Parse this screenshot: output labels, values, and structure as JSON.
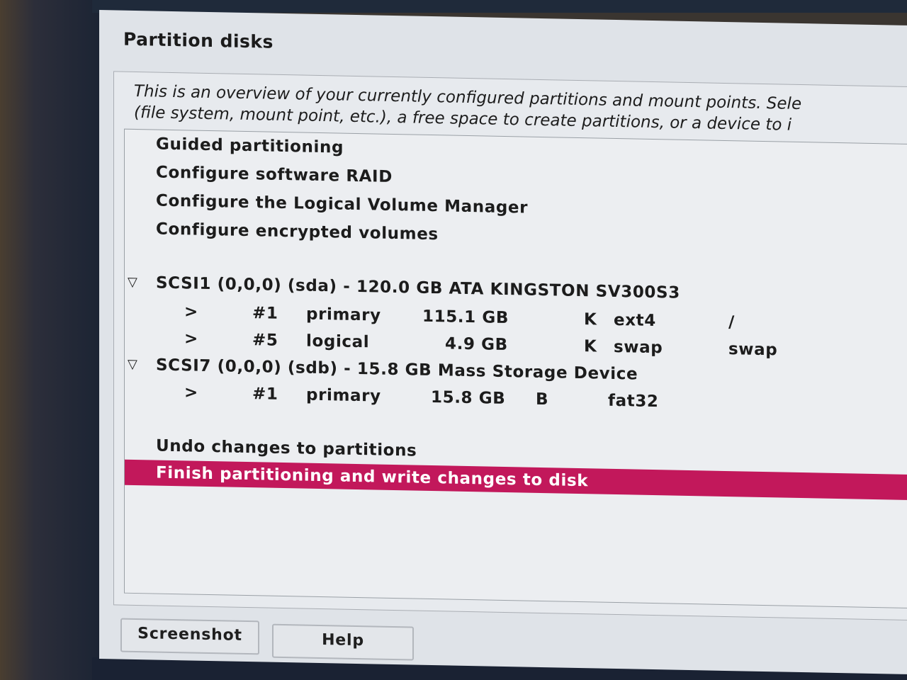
{
  "window": {
    "title": "Partition disks"
  },
  "intro": {
    "line1": "This is an overview of your currently configured partitions and mount points. Sele",
    "line2": "(file system, mount point, etc.), a free space to create partitions, or a device to i"
  },
  "menu": [
    "Guided partitioning",
    "Configure software RAID",
    "Configure the Logical Volume Manager",
    "Configure encrypted volumes"
  ],
  "disks": [
    {
      "label": "SCSI1 (0,0,0) (sda) - 120.0 GB ATA KINGSTON SV300S3",
      "partitions": [
        {
          "arrow": ">",
          "num": "#1",
          "type": "primary",
          "size": "115.1 GB",
          "flag": "K",
          "fs": "ext4",
          "mount": "/"
        },
        {
          "arrow": ">",
          "num": "#5",
          "type": "logical",
          "size": "4.9 GB",
          "flag": "K",
          "fs": "swap",
          "mount": "swap"
        }
      ]
    },
    {
      "label": "SCSI7 (0,0,0) (sdb) - 15.8 GB Mass Storage Device",
      "partitions": [
        {
          "arrow": ">",
          "num": "#1",
          "type": "primary",
          "size": "15.8 GB",
          "flag": "B",
          "fs": "fat32",
          "mount": ""
        }
      ]
    }
  ],
  "actions": {
    "undo": "Undo changes to partitions",
    "finish": "Finish partitioning and write changes to disk"
  },
  "buttons": {
    "screenshot": "Screenshot",
    "help": "Help"
  },
  "icons": {
    "expander": "triangle-down-icon"
  },
  "colors": {
    "selection": "#c2185b"
  }
}
